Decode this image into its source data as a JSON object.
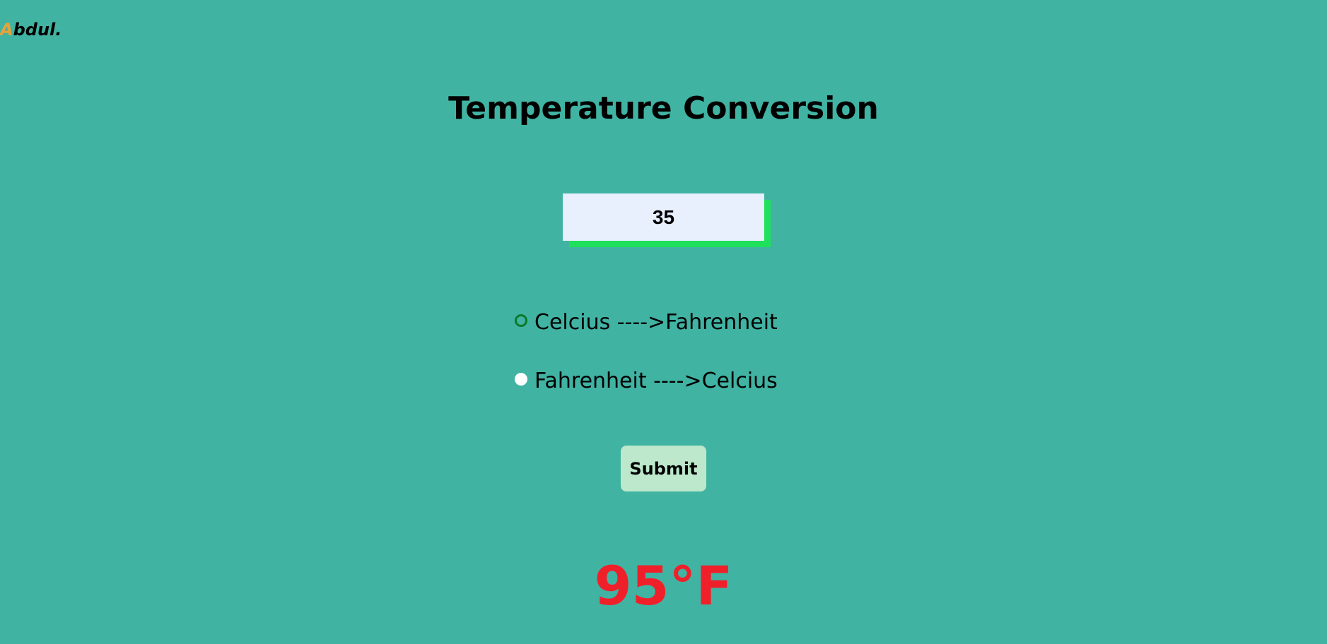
{
  "logo": {
    "first_letter": "A",
    "rest": "bdul."
  },
  "title": "Temperature Conversion",
  "temperature_input": {
    "value": "35"
  },
  "options": [
    {
      "label": "Celcius ---->Fahrenheit",
      "checked": true
    },
    {
      "label": "Fahrenheit ---->Celcius",
      "checked": false
    }
  ],
  "submit_label": "Submit",
  "result": "95°F",
  "colors": {
    "background": "#41b3a3",
    "logo_accent": "#e8a23a",
    "input_shadow": "#1fe05a",
    "input_background": "#e8f0fe",
    "button_background": "#bde8cc",
    "result_text": "#f0202a",
    "radio_checked_border": "#0a7a2a"
  }
}
